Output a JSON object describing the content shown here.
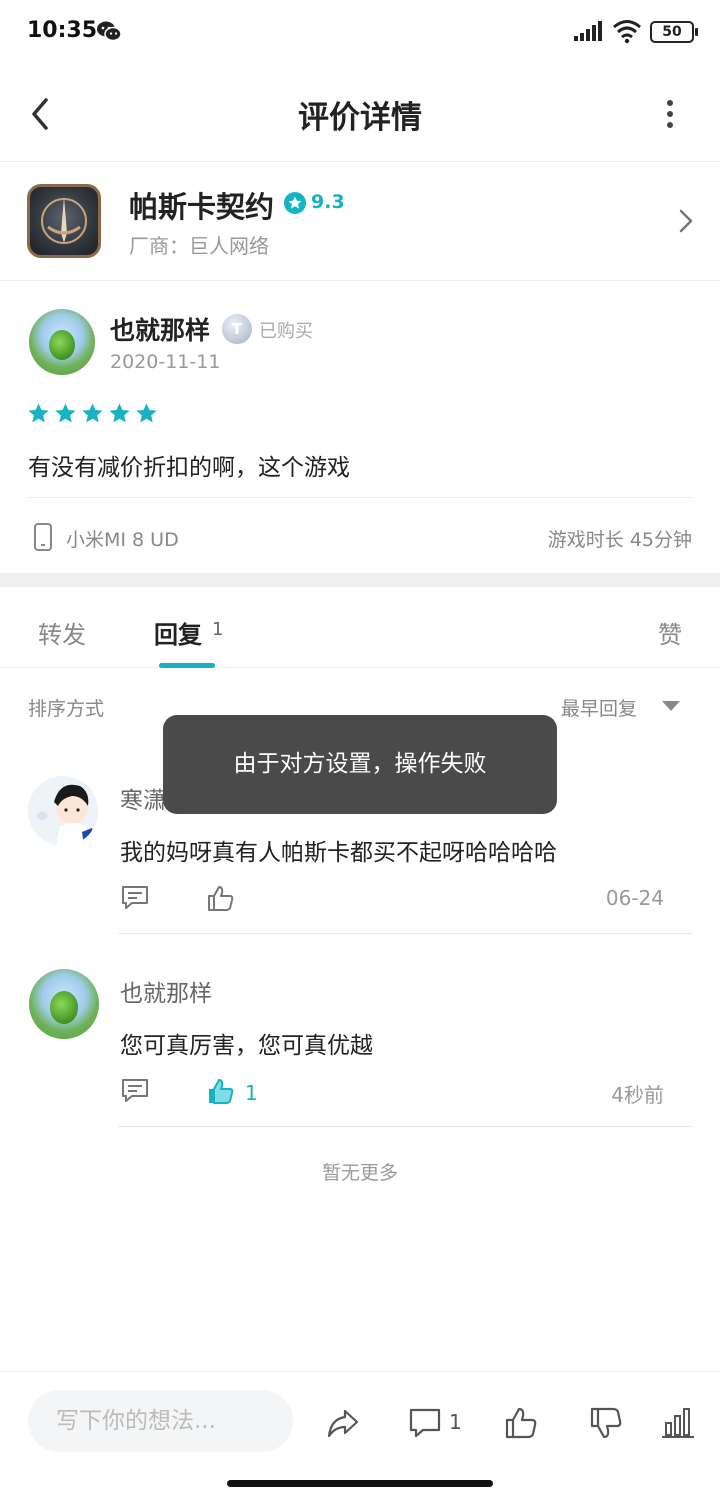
{
  "status_bar": {
    "time": "10:35",
    "battery": "50"
  },
  "header": {
    "title": "评价详情"
  },
  "game": {
    "name": "帕斯卡契约",
    "score": "9.3",
    "vendor": "厂商：巨人网络"
  },
  "review": {
    "author": "也就那样",
    "level": "T",
    "purchased": "已购买",
    "date": "2020-11-11",
    "stars": 5,
    "text": "有没有减价折扣的啊，这个游戏",
    "device": "小米MI 8 UD",
    "playtime": "游戏时长 45分钟"
  },
  "tabs": {
    "forward": "转发",
    "reply": "回复",
    "reply_count": "1",
    "like": "赞"
  },
  "sort": {
    "label": "排序方式",
    "selected": "最早回复"
  },
  "replies": [
    {
      "author": "寒潇",
      "text": "我的妈呀真有人帕斯卡都买不起呀哈哈哈哈",
      "time": "06-24",
      "likes": ""
    },
    {
      "author": "也就那样",
      "text": "您可真厉害，您可真优越",
      "time": "4秒前",
      "likes": "1"
    }
  ],
  "no_more": "暂无更多",
  "toast": "由于对方设置，操作失败",
  "bottom_bar": {
    "placeholder": "写下你的想法...",
    "comment_count": "1"
  },
  "colors": {
    "accent": "#17b3c2",
    "toast_bg": "#4a4a4a"
  }
}
